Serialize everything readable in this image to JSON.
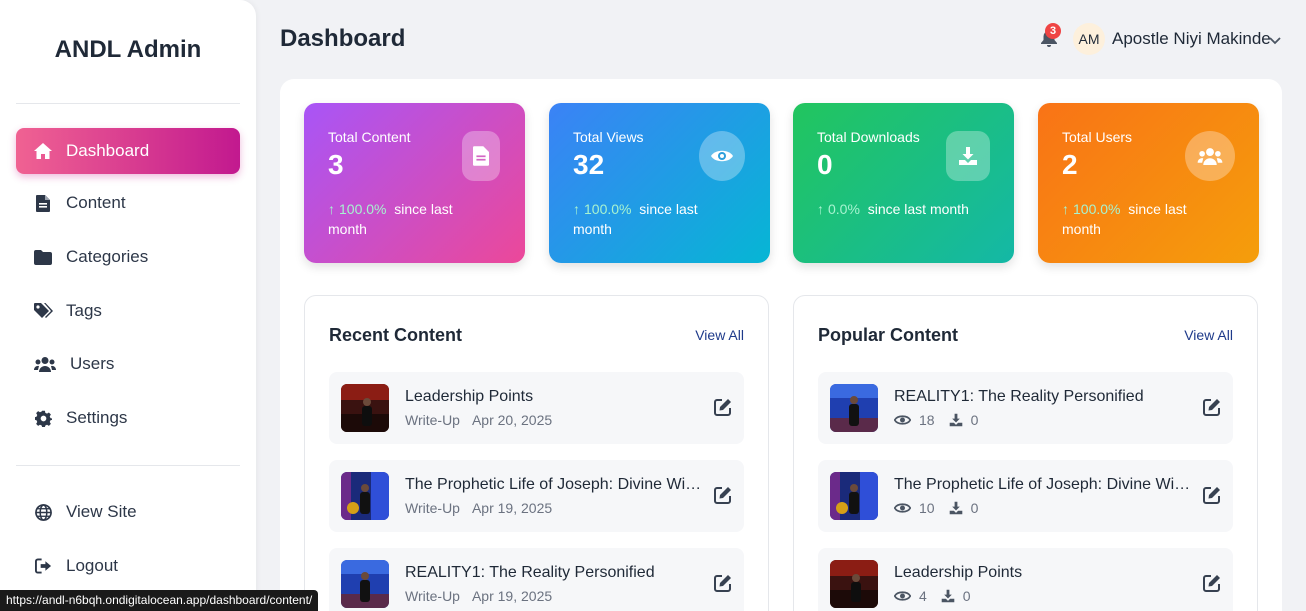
{
  "sidebar": {
    "brand": "ANDL Admin",
    "nav": [
      {
        "label": "Dashboard",
        "icon": "home-icon",
        "active": true
      },
      {
        "label": "Content",
        "icon": "file-icon"
      },
      {
        "label": "Categories",
        "icon": "folder-icon"
      },
      {
        "label": "Tags",
        "icon": "tags-icon"
      },
      {
        "label": "Users",
        "icon": "users-icon"
      },
      {
        "label": "Settings",
        "icon": "gear-icon"
      }
    ],
    "footer_nav": [
      {
        "label": "View Site",
        "icon": "globe-icon"
      },
      {
        "label": "Logout",
        "icon": "logout-icon"
      }
    ]
  },
  "header": {
    "title": "Dashboard",
    "notifications_count": "3",
    "avatar_initials": "AM",
    "user_name": "Apostle Niyi Makinde"
  },
  "stats": [
    {
      "label": "Total Content",
      "value": "3",
      "change": "100.0%",
      "suffix": "since last month",
      "icon": "file-icon"
    },
    {
      "label": "Total Views",
      "value": "32",
      "change": "100.0%",
      "suffix": "since last month",
      "icon": "eye-icon"
    },
    {
      "label": "Total Downloads",
      "value": "0",
      "change": "0.0%",
      "suffix": "since last month",
      "icon": "download-icon"
    },
    {
      "label": "Total Users",
      "value": "2",
      "change": "100.0%",
      "suffix": "since last month",
      "icon": "users-icon"
    }
  ],
  "recent": {
    "title": "Recent Content",
    "view_all": "View All",
    "items": [
      {
        "title": "Leadership Points",
        "type": "Write-Up",
        "date": "Apr 20, 2025"
      },
      {
        "title": "The Prophetic Life of Joseph: Divine Wisdom",
        "type": "Write-Up",
        "date": "Apr 19, 2025"
      },
      {
        "title": "REALITY1: The Reality Personified",
        "type": "Write-Up",
        "date": "Apr 19, 2025"
      }
    ]
  },
  "popular": {
    "title": "Popular Content",
    "view_all": "View All",
    "items": [
      {
        "title": "REALITY1: The Reality Personified",
        "views": "18",
        "downloads": "0"
      },
      {
        "title": "The Prophetic Life of Joseph: Divine Wisdom",
        "views": "10",
        "downloads": "0"
      },
      {
        "title": "Leadership Points",
        "views": "4",
        "downloads": "0"
      }
    ]
  },
  "status_url": "https://andl-n6bqh.ondigitalocean.app/dashboard/content/"
}
